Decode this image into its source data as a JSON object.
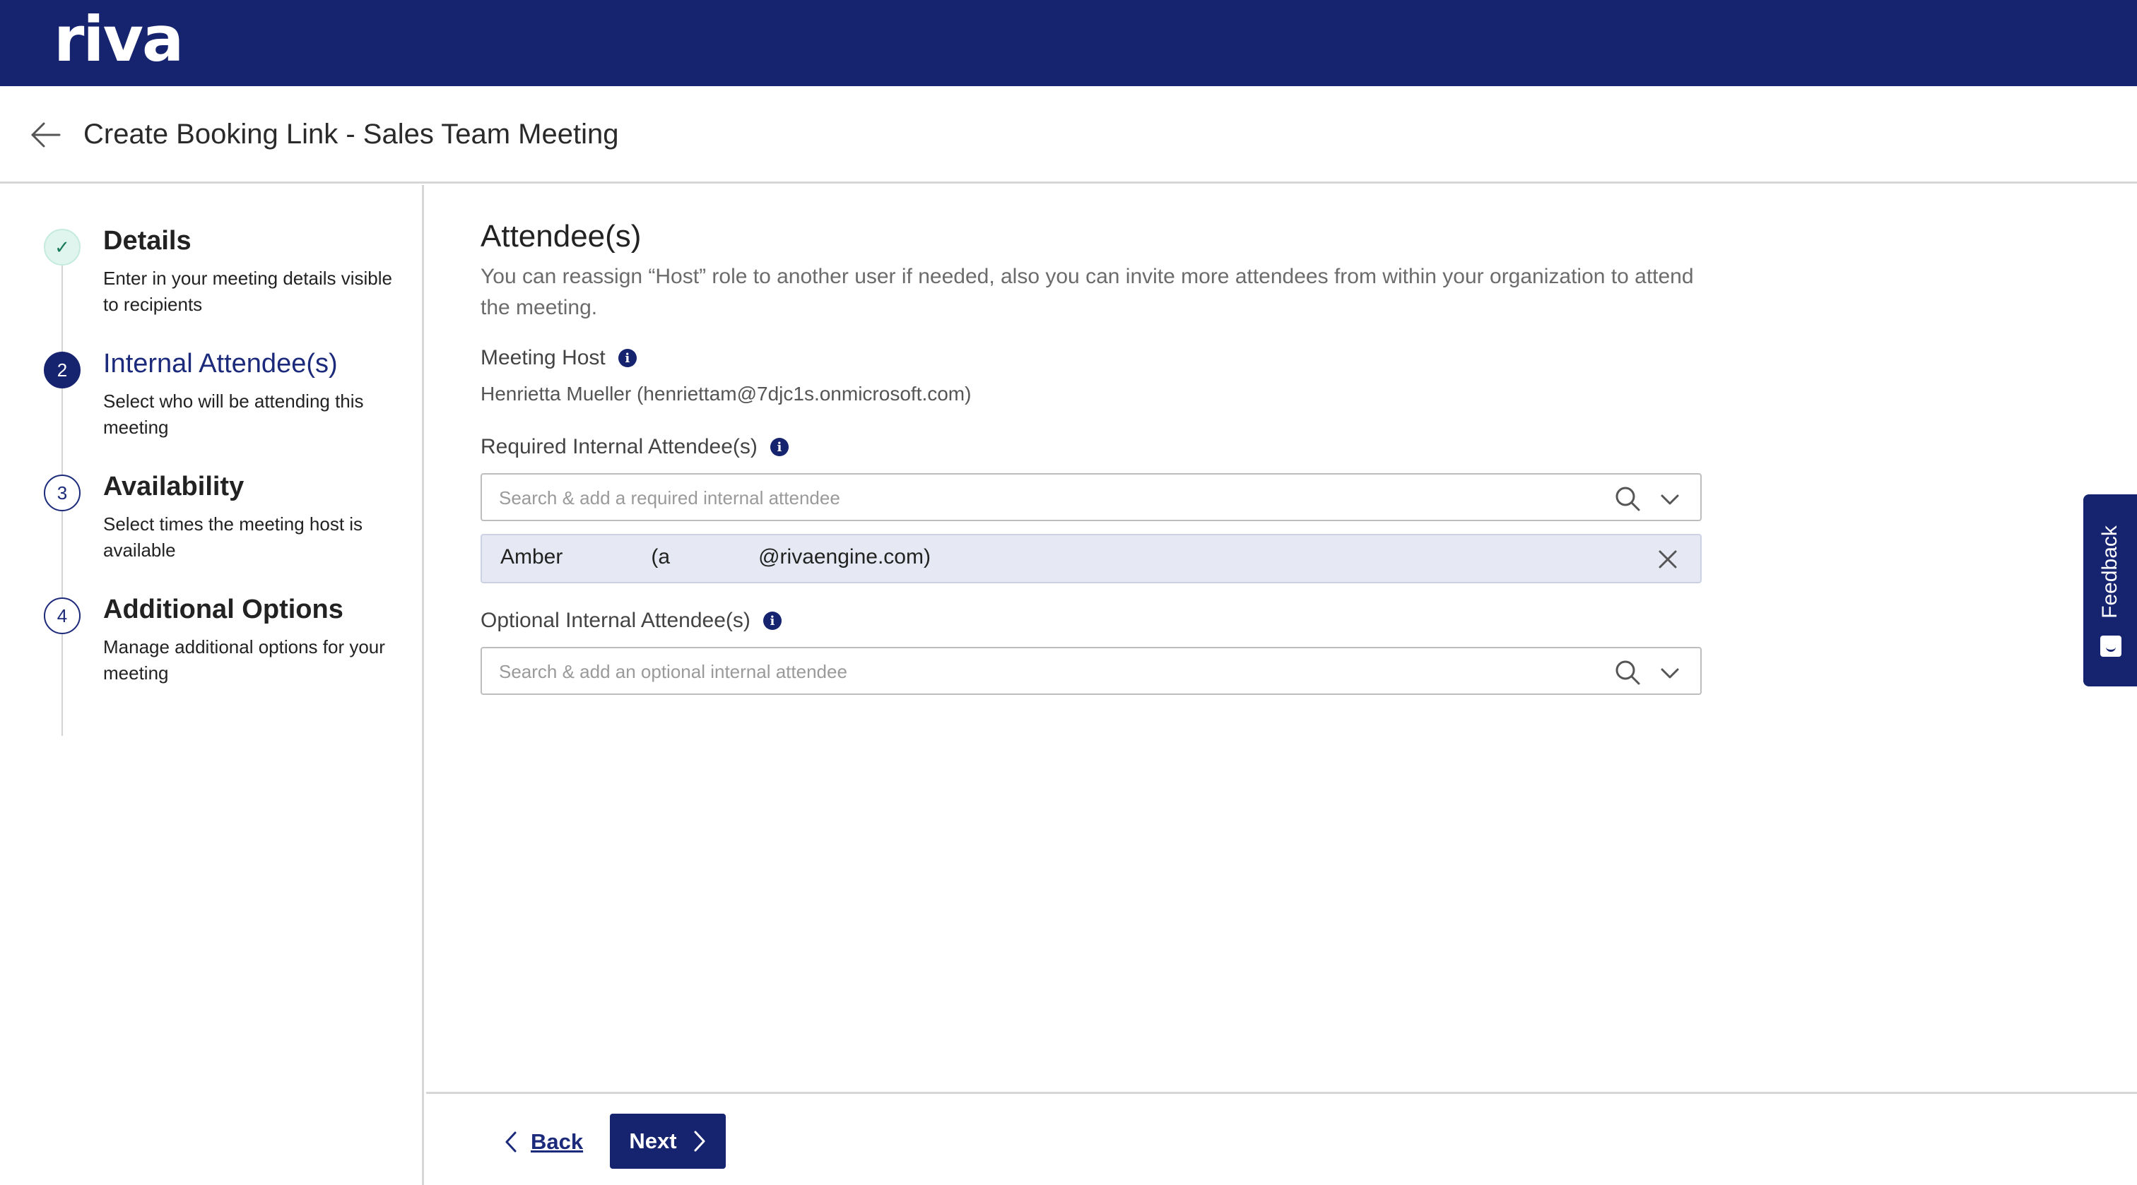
{
  "brand": {
    "logo_text": "riva"
  },
  "header": {
    "title": "Create Booking Link - Sales Team Meeting"
  },
  "steps": [
    {
      "number": "✓",
      "title": "Details",
      "description": "Enter in your meeting details visible to recipients",
      "state": "done"
    },
    {
      "number": "2",
      "title": "Internal Attendee(s)",
      "description": "Select who will be attending this meeting",
      "state": "active"
    },
    {
      "number": "3",
      "title": "Availability",
      "description": "Select times the meeting host is available",
      "state": "pending"
    },
    {
      "number": "4",
      "title": "Additional Options",
      "description": "Manage additional options for your meeting",
      "state": "pending"
    }
  ],
  "main": {
    "title": "Attendee(s)",
    "description": "You can reassign “Host” role to another user if needed, also you can invite more attendees from within your organization to attend the meeting.",
    "meeting_host": {
      "label": "Meeting Host",
      "value": "Henrietta Mueller (henriettam@7djc1s.onmicrosoft.com)"
    },
    "required": {
      "label": "Required Internal Attendee(s)",
      "placeholder": "Search & add a required internal attendee",
      "value": "",
      "selected": "Amber               (a               @rivaengine.com)"
    },
    "optional": {
      "label": "Optional Internal Attendee(s)",
      "placeholder": "Search & add an optional internal attendee",
      "value": ""
    }
  },
  "footer": {
    "back_label": "Back",
    "next_label": "Next"
  },
  "feedback": {
    "label": "Feedback"
  },
  "icons": {
    "back": "arrow-left-icon",
    "info": "info-icon",
    "search": "search-icon",
    "dropdown": "chevron-down-icon",
    "remove": "close-icon",
    "feedback": "smiley-icon"
  },
  "colors": {
    "brand": "#16236f",
    "done_step_bg": "#dff5ee",
    "chip_bg": "#e6e9f3",
    "muted_text": "#6b6b6b"
  }
}
